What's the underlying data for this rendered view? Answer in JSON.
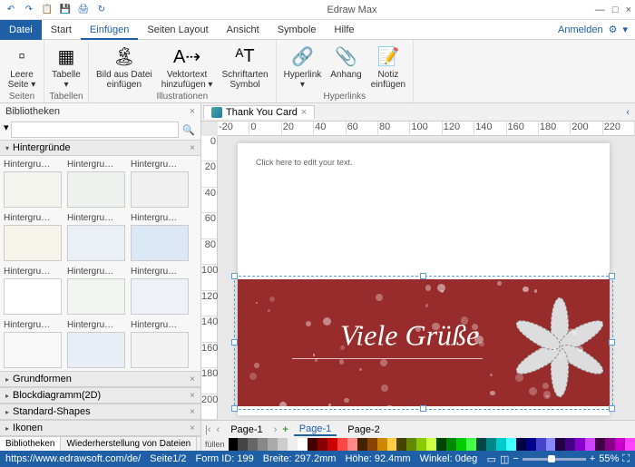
{
  "title": "Edraw Max",
  "qat": [
    "↶",
    "↷",
    "📋",
    "💾",
    "🖨",
    "↻"
  ],
  "win": {
    "min": "—",
    "max": "□",
    "close": "×"
  },
  "signin": "Anmelden",
  "tabs": {
    "file": "Datei",
    "items": [
      "Start",
      "Einfügen",
      "Seiten Layout",
      "Ansicht",
      "Symbole",
      "Hilfe"
    ],
    "active": "Einfügen"
  },
  "ribbon": [
    {
      "label": "Seiten",
      "items": [
        {
          "icon": "▫",
          "label": "Leere\nSeite ▾"
        }
      ]
    },
    {
      "label": "Tabellen",
      "items": [
        {
          "icon": "▦",
          "label": "Tabelle\n▾"
        }
      ]
    },
    {
      "label": "Illustrationen",
      "items": [
        {
          "icon": "🏝",
          "label": "Bild aus Datei\neinfügen"
        },
        {
          "icon": "A⇢",
          "label": "Vektortext\nhinzufügen ▾"
        },
        {
          "icon": "ᴬT",
          "label": "Schriftarten\nSymbol"
        }
      ]
    },
    {
      "label": "Hyperlinks",
      "items": [
        {
          "icon": "🔗",
          "label": "Hyperlink\n▾"
        },
        {
          "icon": "📎",
          "label": "Anhang"
        },
        {
          "icon": "📝",
          "label": "Notiz\neinfügen"
        }
      ]
    }
  ],
  "sidebar": {
    "title": "Bibliotheken",
    "search_ph": "",
    "cat": "Hintergründe",
    "thumb_label": "Hintergru…",
    "cats": [
      "Grundformen",
      "Blockdiagramm(2D)",
      "Standard-Shapes",
      "Ikonen"
    ],
    "tabs": [
      "Bibliotheken",
      "Wiederherstellung von Dateien"
    ]
  },
  "doc": {
    "tab": "Thank You Card",
    "hint": "Click here to edit your text.",
    "greeting": "Viele Grüße"
  },
  "ruler_h": [
    "-20",
    "0",
    "20",
    "40",
    "60",
    "80",
    "100",
    "120",
    "140",
    "160",
    "180",
    "200",
    "220"
  ],
  "ruler_v": [
    "0",
    "20",
    "40",
    "60",
    "80",
    "100",
    "120",
    "140",
    "160",
    "180",
    "200"
  ],
  "pages": {
    "list": [
      "Page-1",
      "Page-1",
      "Page-2"
    ],
    "active": 1,
    "fill": "füllen"
  },
  "status": {
    "url": "https://www.edrawsoft.com/de/",
    "page": "Seite1/2",
    "form": "Form ID: 199",
    "w": "Breite: 297.2mm",
    "h": "Höhe: 92.4mm",
    "a": "Winkel: 0deg",
    "zoom": "55%"
  },
  "palette": [
    "#000",
    "#444",
    "#666",
    "#888",
    "#aaa",
    "#ccc",
    "#eee",
    "#fff",
    "#400",
    "#800",
    "#c00",
    "#f44",
    "#f88",
    "#420",
    "#840",
    "#c80",
    "#fc4",
    "#440",
    "#680",
    "#8c0",
    "#cf4",
    "#040",
    "#080",
    "#0c0",
    "#4f4",
    "#044",
    "#088",
    "#0cc",
    "#4ff",
    "#004",
    "#008",
    "#44c",
    "#88f",
    "#204",
    "#408",
    "#80c",
    "#c4f",
    "#404",
    "#808",
    "#c0c",
    "#f4f"
  ]
}
